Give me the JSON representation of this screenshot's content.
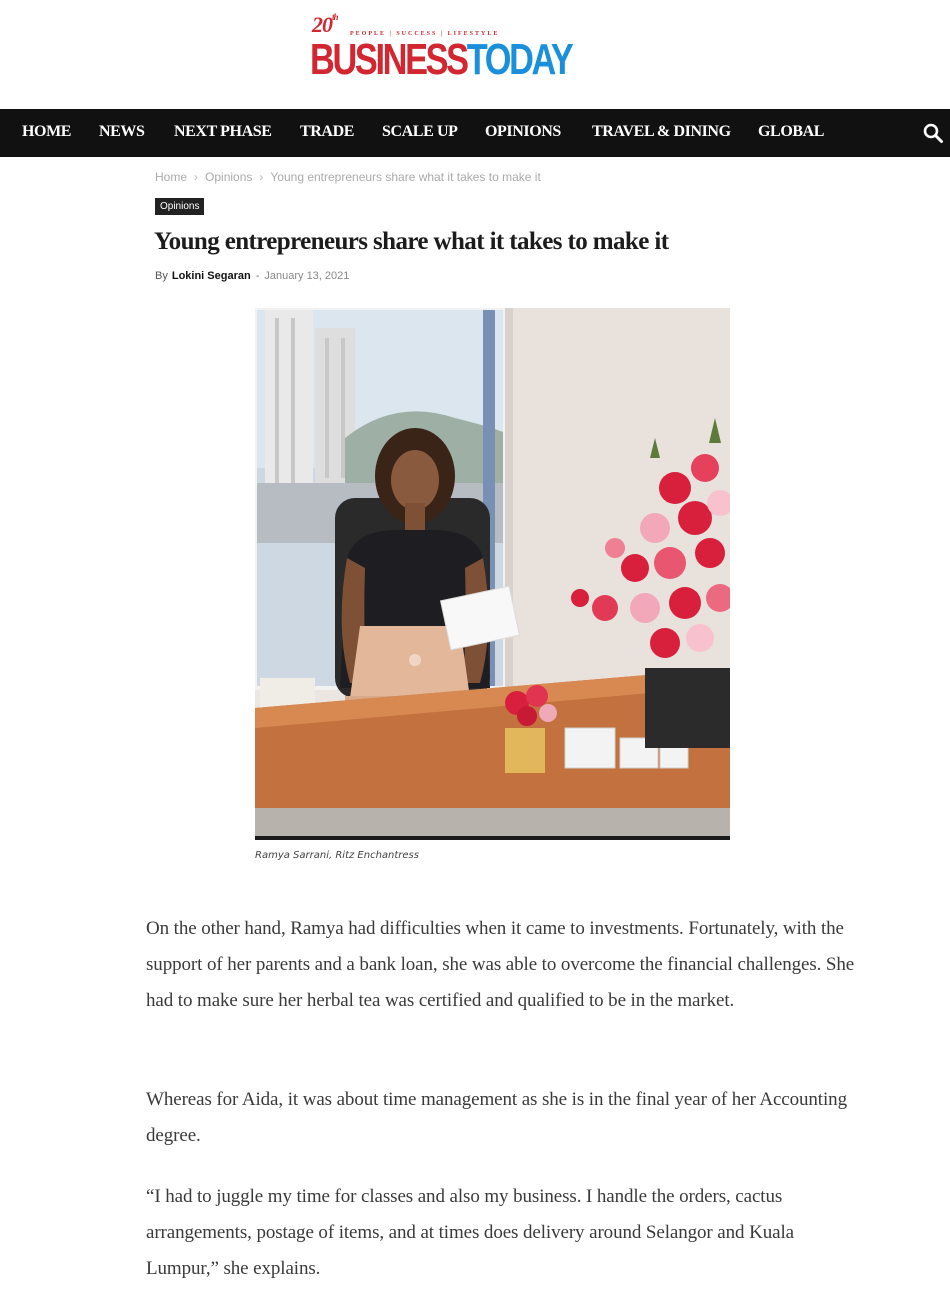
{
  "logo": {
    "badge_number": "20",
    "badge_sup": "th",
    "tagline": "PEOPLE | SUCCESS | LIFESTYLE",
    "word_business": "BUSINESS",
    "word_today": "TODAY",
    "colors": {
      "red": "#d22630",
      "blue": "#1a8fdc"
    }
  },
  "nav": {
    "items": [
      "HOME",
      "NEWS",
      "NEXT PHASE",
      "TRADE",
      "SCALE UP",
      "OPINIONS",
      "TRAVEL & DINING",
      "GLOBAL"
    ],
    "search_icon": "search-icon",
    "background": "#111111"
  },
  "breadcrumb": {
    "items": [
      "Home",
      "Opinions",
      "Young entrepreneurs share what it takes to make it"
    ],
    "separator": "›"
  },
  "article": {
    "category": "Opinions",
    "title": "Young entrepreneurs share what it takes to make it",
    "by_label": "By",
    "author": "Lokini Segaran",
    "date_separator": "-",
    "date": "January 13, 2021",
    "image_caption": "Ramya Sarrani, Ritz Enchantress",
    "paragraphs": [
      "On the other hand, Ramya had difficulties when it came to investments. Fortunately, with the support of her parents and a bank loan, she was able to overcome the financial challenges. She had to make sure her herbal tea was certified and qualified to be in the market.",
      "Whereas for Aida, it was about time management as she is in the final year of her Accounting degree.",
      "“I had to juggle my time for classes and also my business. I handle the orders, cactus arrangements, postage of items, and at times does delivery around Selangor and Kuala Lumpur,” she explains."
    ]
  }
}
